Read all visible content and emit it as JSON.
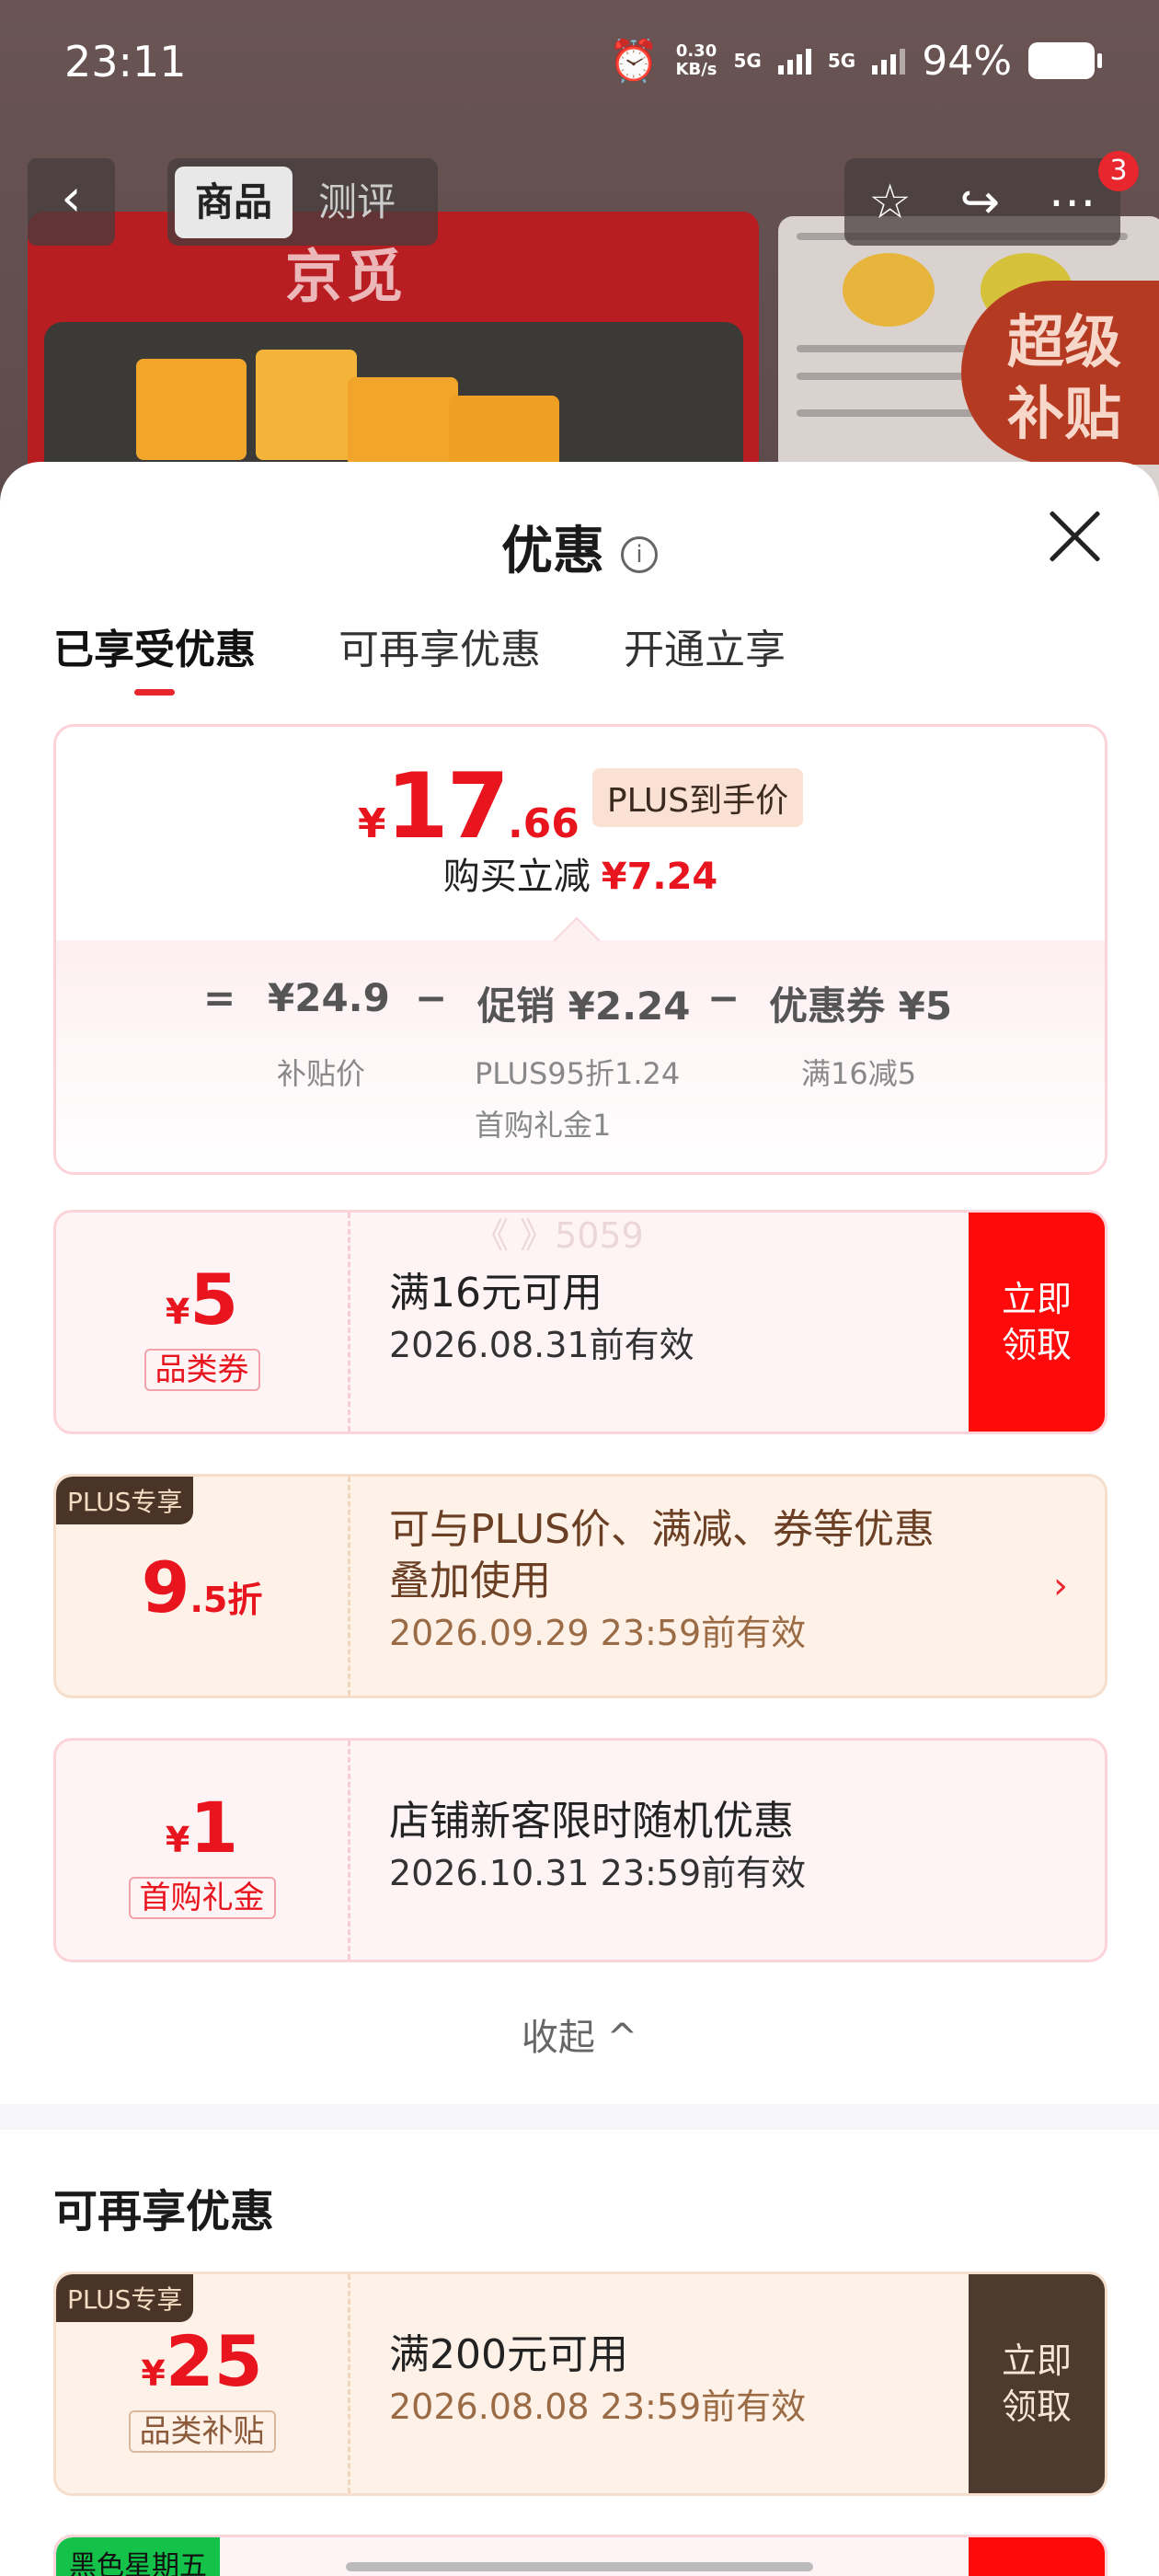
{
  "status_bar": {
    "time": "23:11",
    "net_speed": "0.30",
    "net_unit": "KB/s",
    "sig1": "5G",
    "sig2": "5G",
    "battery": "94%"
  },
  "nav": {
    "tabs": [
      "商品",
      "测评"
    ],
    "badge": "3"
  },
  "background": {
    "brand": "京觅",
    "super_badge": "超级补贴"
  },
  "sheet": {
    "title": "优惠",
    "tabs": [
      "已享受优惠",
      "可再享优惠",
      "开通立享"
    ],
    "summary": {
      "yen": "¥",
      "price_int": "17",
      "price_dec": ".66",
      "plus_tag": "PLUS到手价",
      "reduce_label": "购买立减",
      "reduce_value": "¥7.24",
      "eq": "=",
      "base_price": "¥24.9",
      "base_label": "补贴价",
      "minus": "−",
      "promo": "促销 ¥2.24",
      "promo_sub1": "PLUS95折1.24",
      "promo_sub2": "首购礼金1",
      "coupon": "优惠券 ¥5",
      "coupon_sub": "满16减5"
    },
    "coupons": [
      {
        "yen": "¥",
        "amount": "5",
        "suffix": "",
        "type": "品类券",
        "line1": "满16元可用",
        "line2": "2026.08.31前有效",
        "button": "立即领取",
        "corner": ""
      },
      {
        "yen": "",
        "amount": "9",
        "suffix": ".5折",
        "type": "",
        "line1": "可与PLUS价、满减、券等优惠",
        "line1b": "叠加使用",
        "line2": "2026.09.29 23:59前有效",
        "corner": "PLUS专享"
      },
      {
        "yen": "¥",
        "amount": "1",
        "suffix": "",
        "type": "首购礼金",
        "line1": "店铺新客限时随机优惠",
        "line2": "2026.10.31 23:59前有效"
      }
    ],
    "collapse": "收起 ^",
    "watermark": "《 》5059",
    "section2_title": "可再享优惠",
    "more_coupons": [
      {
        "corner": "PLUS专享",
        "yen": "¥",
        "amount": "25",
        "type": "品类补贴",
        "line1": "满200元可用",
        "line2": "2026.08.08 23:59前有效",
        "button": "立即领取"
      },
      {
        "corner": "黑色星期五"
      }
    ]
  }
}
